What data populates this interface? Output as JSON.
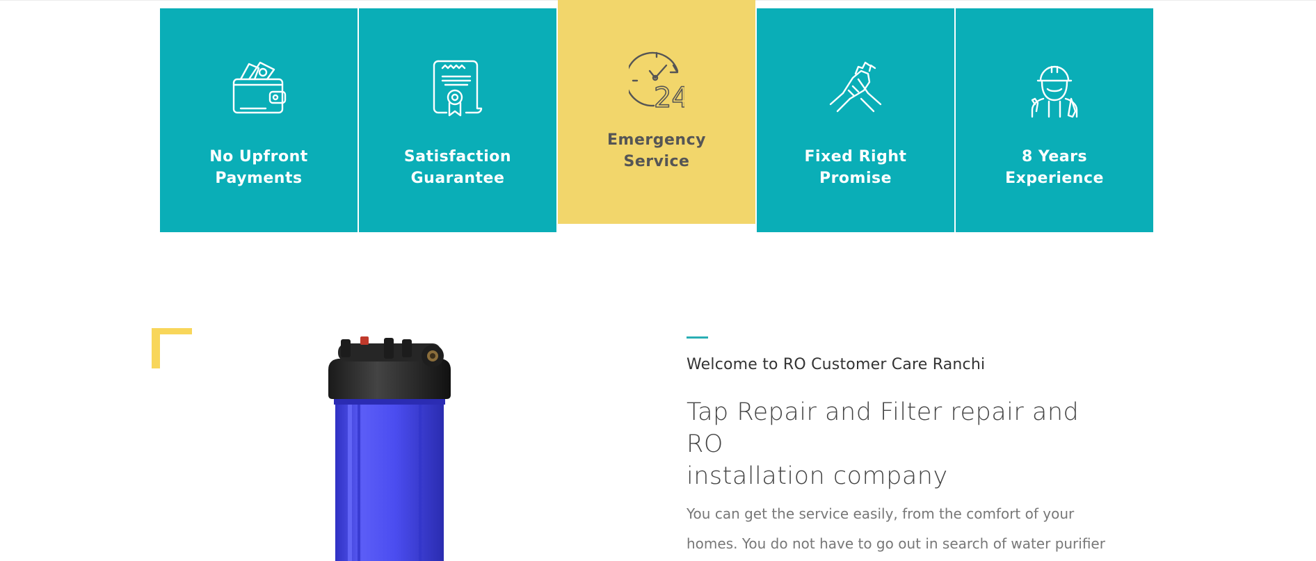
{
  "features": [
    {
      "label_line1": "No Upfront",
      "label_line2": "Payments",
      "icon": "wallet-icon"
    },
    {
      "label_line1": "Satisfaction",
      "label_line2": "Guarantee",
      "icon": "certificate-icon"
    },
    {
      "label_line1": "Emergency",
      "label_line2": "Service",
      "icon": "24-hour-clock-icon"
    },
    {
      "label_line1": "Fixed Right",
      "label_line2": "Promise",
      "icon": "handshake-icon"
    },
    {
      "label_line1": "8 Years",
      "label_line2": "Experience",
      "icon": "technician-icon"
    }
  ],
  "clock_number": "24",
  "about": {
    "eyebrow": "Welcome to RO Customer Care Ranchi",
    "headline_line1": "Tap Repair and Filter repair and RO",
    "headline_line2": "installation company",
    "paragraph_line1": "You can get the service easily, from the comfort of your",
    "paragraph_line2": "homes. You do not have to go out in search of water purifier"
  },
  "colors": {
    "tile": "#0aaeb7",
    "tile_active": "#f2d66b",
    "accent": "#29aeb4",
    "corner": "#f8d65a",
    "filter_body": "#4b4df0"
  }
}
